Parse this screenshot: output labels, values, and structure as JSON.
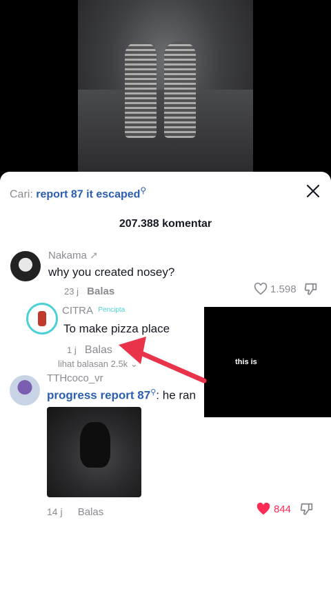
{
  "search": {
    "prefix": "Cari:",
    "query": "report 87 it escaped"
  },
  "comments_count": "207.388 komentar",
  "comment1": {
    "user": "Nakama",
    "text": "why you created nosey?",
    "time": "23 j",
    "reply": "Balas",
    "likes": "1.598"
  },
  "reply1": {
    "user": "CITRA",
    "badge": "Pencipta",
    "text": "To make pizza place",
    "time": "1 j",
    "reply": "Balas",
    "more": "lihat balasan 2.5k"
  },
  "overlay": {
    "text": "this is"
  },
  "comment2": {
    "user": "TTHcoco_vr",
    "link": "progress report 87",
    "text": ": he ran",
    "time": "14 j",
    "reply": "Balas",
    "likes": "844"
  },
  "colors": {
    "accent_blue": "#2b5db0",
    "like_red": "#fe2c55",
    "arrow_red": "#e8334a",
    "creator_badge": "#4bd0d6"
  }
}
